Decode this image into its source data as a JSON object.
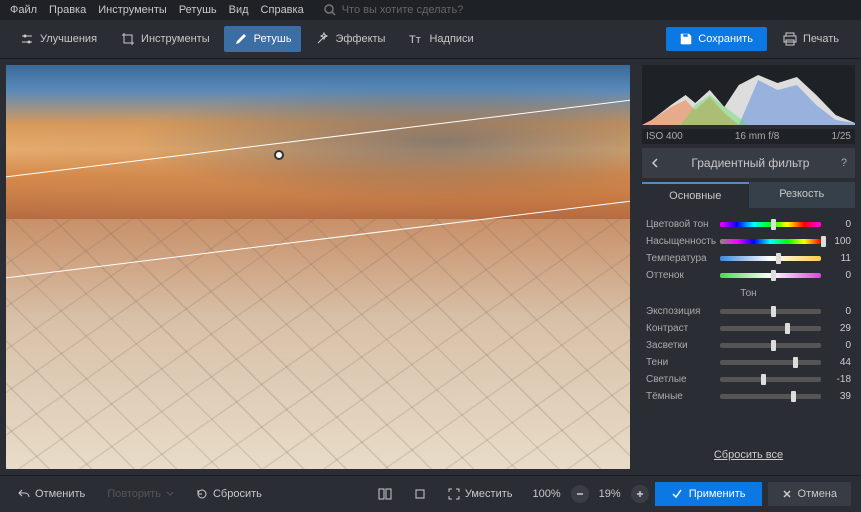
{
  "menubar": [
    "Файл",
    "Правка",
    "Инструменты",
    "Ретушь",
    "Вид",
    "Справка"
  ],
  "search_placeholder": "Что вы хотите сделать?",
  "tabs": {
    "enhance": "Улучшения",
    "tools": "Инструменты",
    "retouch": "Ретушь",
    "effects": "Эффекты",
    "captions": "Надписи"
  },
  "actions": {
    "save": "Сохранить",
    "print": "Печать"
  },
  "meta": {
    "iso": "ISO 400",
    "lens": "16 mm f/8",
    "shutter": "1/25"
  },
  "panel": {
    "title": "Градиентный фильтр",
    "tab_basic": "Основные",
    "tab_sharp": "Резкость",
    "section_tone": "Тон",
    "reset": "Сбросить все"
  },
  "sliders": {
    "hue": {
      "label": "Цветовой тон",
      "value": 0,
      "pos": 50,
      "bg": "linear-gradient(90deg,#f0f,#00f,#0ff,#0f0,#ff0,#f00,#f0f)"
    },
    "sat": {
      "label": "Насыщенность",
      "value": 100,
      "pos": 100,
      "bg": "linear-gradient(90deg,#888,#f0f,#00f,#0ff,#0f0,#ff0,#f00)"
    },
    "temp": {
      "label": "Температура",
      "value": 11,
      "pos": 55,
      "bg": "linear-gradient(90deg,#48d,#fff,#fc4)"
    },
    "tint": {
      "label": "Оттенок",
      "value": 0,
      "pos": 50,
      "bg": "linear-gradient(90deg,#4d4,#fff,#d4d)"
    },
    "expo": {
      "label": "Экспозиция",
      "value": 0,
      "pos": 50,
      "bg": "#555"
    },
    "contrast": {
      "label": "Контраст",
      "value": 29,
      "pos": 64,
      "bg": "#555"
    },
    "highlights": {
      "label": "Засветки",
      "value": 0,
      "pos": 50,
      "bg": "#555"
    },
    "shadows": {
      "label": "Тени",
      "value": 44,
      "pos": 72,
      "bg": "#555"
    },
    "whites": {
      "label": "Светлые",
      "value": -18,
      "pos": 41,
      "bg": "#555"
    },
    "blacks": {
      "label": "Тёмные",
      "value": 39,
      "pos": 70,
      "bg": "#555"
    }
  },
  "bottom": {
    "undo": "Отменить",
    "redo": "Повторить",
    "reset": "Сбросить",
    "fit": "Уместить",
    "zoom1": "100%",
    "zoom2": "19%",
    "apply": "Применить",
    "cancel": "Отмена"
  }
}
